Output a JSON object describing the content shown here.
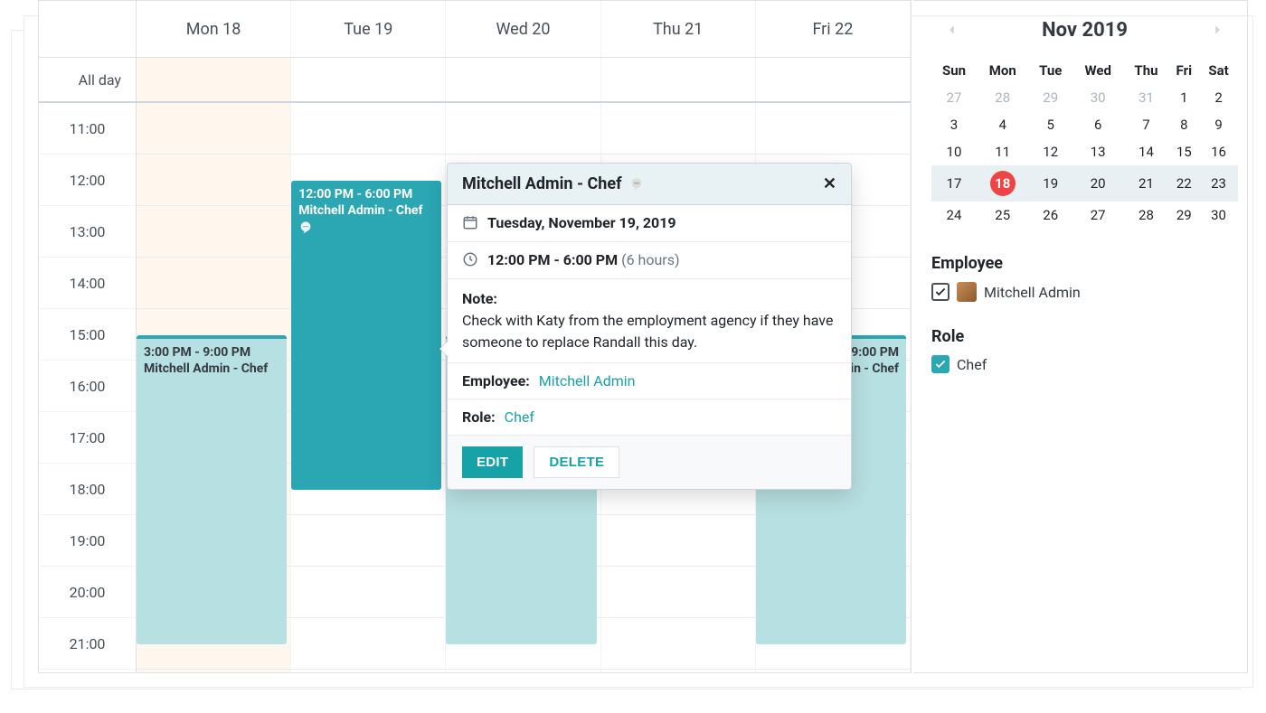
{
  "calendar": {
    "all_day_label": "All day",
    "time_labels": [
      "11:00",
      "12:00",
      "13:00",
      "14:00",
      "15:00",
      "16:00",
      "17:00",
      "18:00",
      "19:00",
      "20:00",
      "21:00"
    ],
    "day_headers": [
      "Mon 18",
      "Tue 19",
      "Wed 20",
      "Thu 21",
      "Fri 22"
    ]
  },
  "events": {
    "tue": {
      "time": "12:00 PM - 6:00 PM",
      "title": "Mitchell Admin - Chef"
    },
    "mon": {
      "time": "3:00 PM - 9:00 PM",
      "title": "Mitchell Admin - Chef"
    },
    "fri": {
      "time": "3:00 PM - 9:00 PM",
      "title": "Mitchell Admin - Chef"
    }
  },
  "popover": {
    "title": "Mitchell Admin - Chef",
    "date_text": "Tuesday, November 19, 2019",
    "time_text": "12:00 PM - 6:00 PM",
    "time_duration": "(6 hours)",
    "note_label": "Note:",
    "note_text": "Check with Katy from the employment agency if they have someone to replace Randall this day.",
    "employee_label": "Employee:",
    "employee_value": "Mitchell Admin",
    "role_label": "Role:",
    "role_value": "Chef",
    "edit_label": "EDIT",
    "delete_label": "DELETE"
  },
  "sidebar": {
    "month_title": "Nov 2019",
    "weekdays": [
      "Sun",
      "Mon",
      "Tue",
      "Wed",
      "Thu",
      "Fri",
      "Sat"
    ],
    "weeks": [
      [
        {
          "n": "27",
          "o": true
        },
        {
          "n": "28",
          "o": true
        },
        {
          "n": "29",
          "o": true
        },
        {
          "n": "30",
          "o": true
        },
        {
          "n": "31",
          "o": true
        },
        {
          "n": "1"
        },
        {
          "n": "2"
        }
      ],
      [
        {
          "n": "3"
        },
        {
          "n": "4"
        },
        {
          "n": "5"
        },
        {
          "n": "6"
        },
        {
          "n": "7"
        },
        {
          "n": "8"
        },
        {
          "n": "9"
        }
      ],
      [
        {
          "n": "10"
        },
        {
          "n": "11"
        },
        {
          "n": "12"
        },
        {
          "n": "13"
        },
        {
          "n": "14"
        },
        {
          "n": "15"
        },
        {
          "n": "16"
        }
      ],
      [
        {
          "n": "17"
        },
        {
          "n": "18",
          "today": true
        },
        {
          "n": "19"
        },
        {
          "n": "20"
        },
        {
          "n": "21"
        },
        {
          "n": "22"
        },
        {
          "n": "23"
        }
      ],
      [
        {
          "n": "24"
        },
        {
          "n": "25"
        },
        {
          "n": "26"
        },
        {
          "n": "27"
        },
        {
          "n": "28"
        },
        {
          "n": "29"
        },
        {
          "n": "30"
        }
      ]
    ],
    "employee_section": "Employee",
    "employee_name": "Mitchell Admin",
    "role_section": "Role",
    "role_name": "Chef"
  }
}
